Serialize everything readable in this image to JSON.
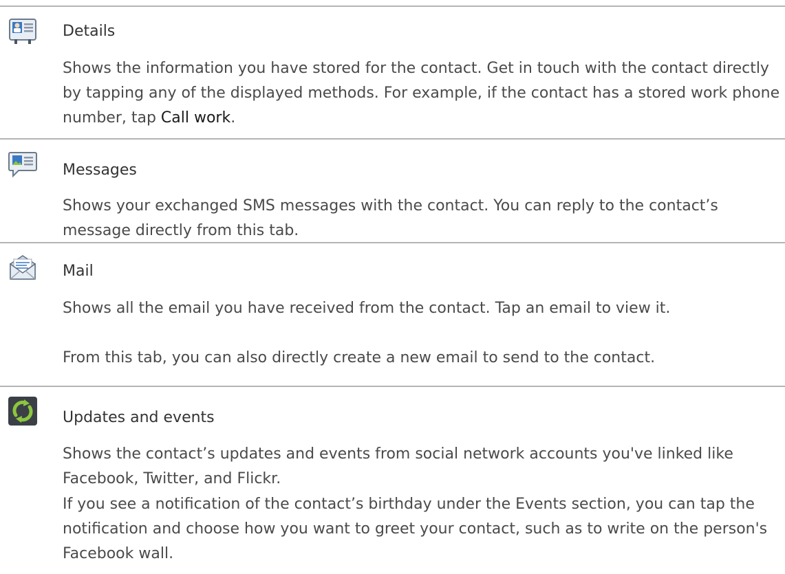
{
  "sections": [
    {
      "title": "Details",
      "icon": "contact-card-icon",
      "paragraphs": [
        {
          "before": "Shows the information you have stored for the contact. Get in touch with the contact directly by tapping any of the displayed methods. For example, if the contact has a stored work phone number, tap ",
          "term": "Call work",
          "after": "."
        }
      ]
    },
    {
      "title": "Messages",
      "icon": "messages-icon",
      "paragraphs": [
        {
          "text": "Shows your exchanged SMS messages with the contact. You can reply to the contact’s message directly from this tab."
        }
      ]
    },
    {
      "title": "Mail",
      "icon": "mail-envelope-icon",
      "paragraphs": [
        {
          "text": "Shows all the email you have received from the contact. Tap an email to view it."
        },
        {
          "text": "From this tab, you can also directly create a new email to send to the contact."
        }
      ]
    },
    {
      "title": "Updates and events",
      "icon": "sync-arrows-icon",
      "paragraphs": [
        {
          "text": "Shows the contact’s updates and events from social network accounts you've linked like Facebook, Twitter, and Flickr."
        },
        {
          "text": "If you see a notification of the contact’s birthday under the Events section, you can tap the notification and choose how you want to greet your contact, such as to write on the person's Facebook wall."
        }
      ]
    }
  ],
  "colors": {
    "rule": "#b4b4b4",
    "body_text": "#4a4a4a",
    "term_text": "#1a1a1a",
    "icon_green": "#8cc63f"
  }
}
